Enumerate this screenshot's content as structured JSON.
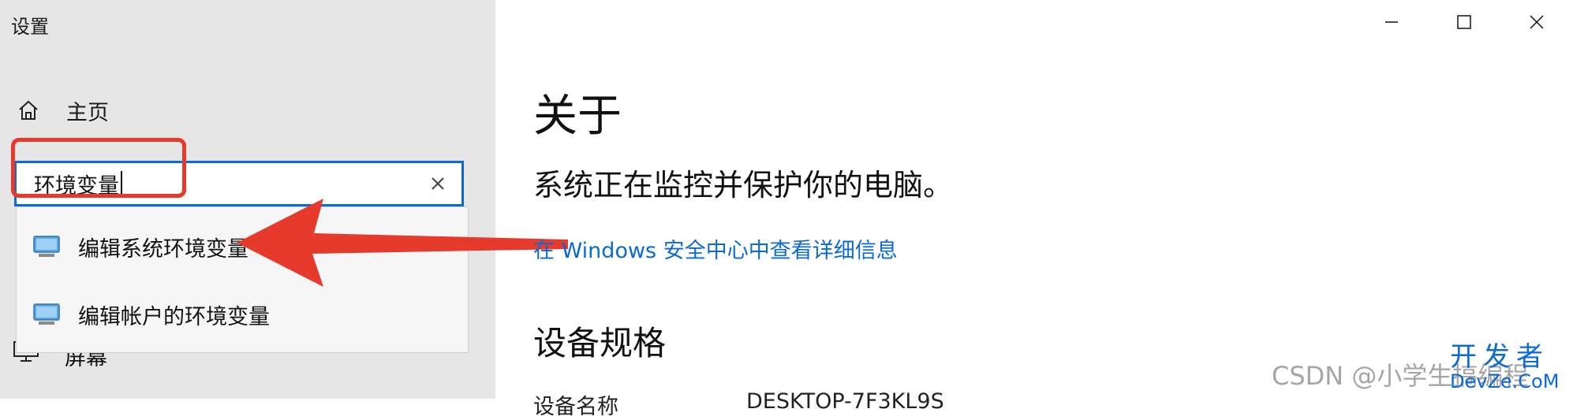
{
  "window": {
    "title": "设置",
    "controls": [
      "minimize-icon",
      "maximize-icon",
      "close-icon"
    ]
  },
  "sidebar": {
    "home_label": "主页",
    "search": {
      "value": "环境变量",
      "placeholder": ""
    },
    "results": [
      {
        "label": "编辑系统环境变量",
        "icon": "monitor-icon"
      },
      {
        "label": "编辑帐户的环境变量",
        "icon": "monitor-icon"
      }
    ],
    "partial_item_label": "屏幕"
  },
  "main": {
    "title": "关于",
    "status": "系统正在监控并保护你的电脑。",
    "security_link": "在 Windows 安全中心中查看详细信息",
    "section_title": "设备规格",
    "spec_label": "设备名称",
    "spec_value": "DESKTOP-7F3KL9S"
  },
  "annotations": {
    "highlight_color": "#e53a2c",
    "arrow_color": "#e53a2c"
  },
  "watermark": {
    "text": "CSDN @小学生搞编程",
    "logo_cn": "开发者",
    "logo_en": "DevZe.CoM"
  },
  "colors": {
    "accent": "#0a6ad6",
    "sidebar_bg": "#e6e6e6",
    "dropdown_bg": "#f6f6f6"
  }
}
